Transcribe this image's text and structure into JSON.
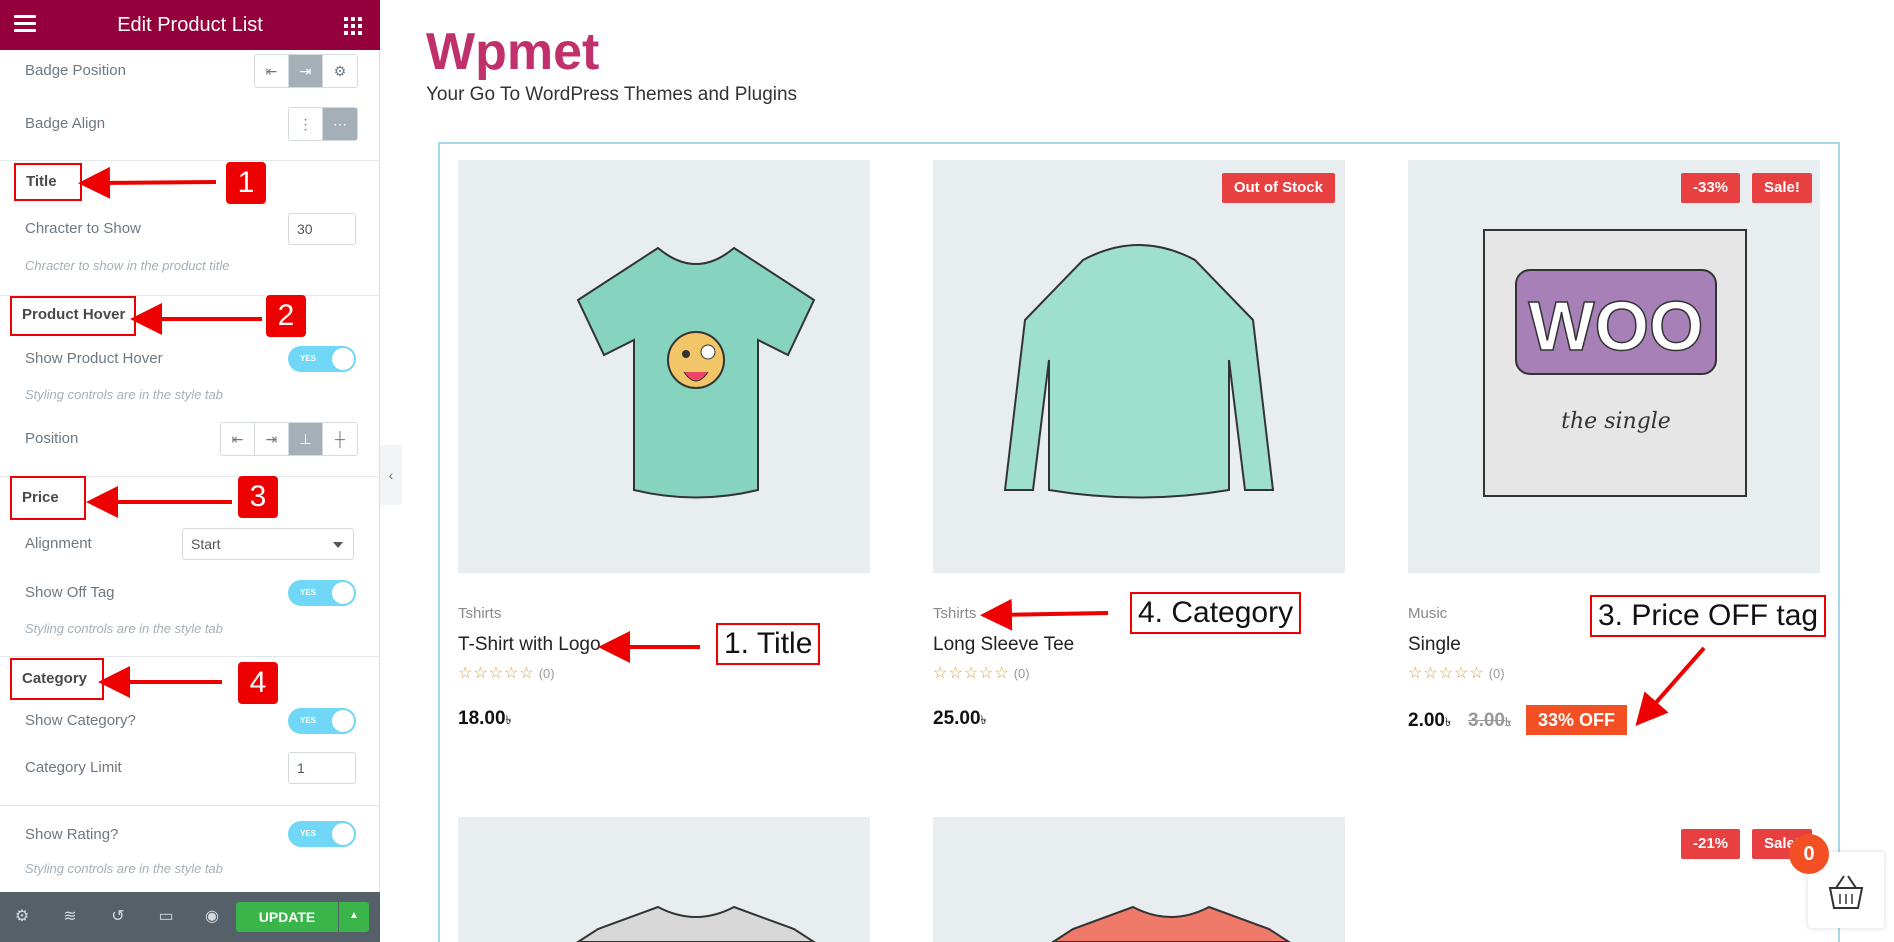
{
  "sidebar": {
    "header_title": "Edit Product List",
    "badge_position_label": "Badge Position",
    "badge_align_label": "Badge Align",
    "title_section": "Title",
    "character_label": "Chracter to Show",
    "character_value": "30",
    "character_hint": "Chracter to show in the product title",
    "hover_section": "Product Hover",
    "show_hover_label": "Show Product Hover",
    "hover_hint": "Styling controls are in the style tab",
    "position_label": "Position",
    "price_section": "Price",
    "alignment_label": "Alignment",
    "alignment_value": "Start",
    "show_off_tag_label": "Show Off Tag",
    "off_tag_hint": "Styling controls are in the style tab",
    "category_section": "Category",
    "show_category_label": "Show Category?",
    "category_limit_label": "Category Limit",
    "category_limit_value": "1",
    "show_rating_label": "Show Rating?",
    "rating_hint": "Styling controls are in the style tab",
    "toggle_yes": "YES",
    "update_label": "UPDATE"
  },
  "annotations": {
    "n1": "1",
    "n2": "2",
    "n3": "3",
    "n4": "4",
    "title_callout": "1. Title",
    "category_callout": "4. Category",
    "price_callout": "3. Price OFF tag"
  },
  "site": {
    "brand": "Wpmet",
    "tagline": "Your Go To WordPress Themes and Plugins"
  },
  "products": [
    {
      "category": "Tshirts",
      "name": "T-Shirt with Logo",
      "rating_count": "(0)",
      "price": "18.00",
      "currency": "৳"
    },
    {
      "category": "Tshirts",
      "name": "Long Sleeve Tee",
      "rating_count": "(0)",
      "price": "25.00",
      "currency": "৳",
      "badge": "Out of Stock"
    },
    {
      "category": "Music",
      "name": "Single",
      "rating_count": "(0)",
      "price": "2.00",
      "currency": "৳",
      "old_price": "3.00",
      "off_tag": "33% OFF",
      "badge_pct": "-33%",
      "badge_sale": "Sale!",
      "image_text_1": "WOO",
      "image_text_2": "the single"
    }
  ],
  "second_row": {
    "badge_pct": "-21%",
    "badge_sale": "Sale!"
  },
  "cart": {
    "count": "0"
  },
  "colors": {
    "header": "#93003c",
    "brand": "#c0306a",
    "accent_red": "#e00000",
    "update": "#39b54a",
    "toggle": "#71d7f7"
  }
}
